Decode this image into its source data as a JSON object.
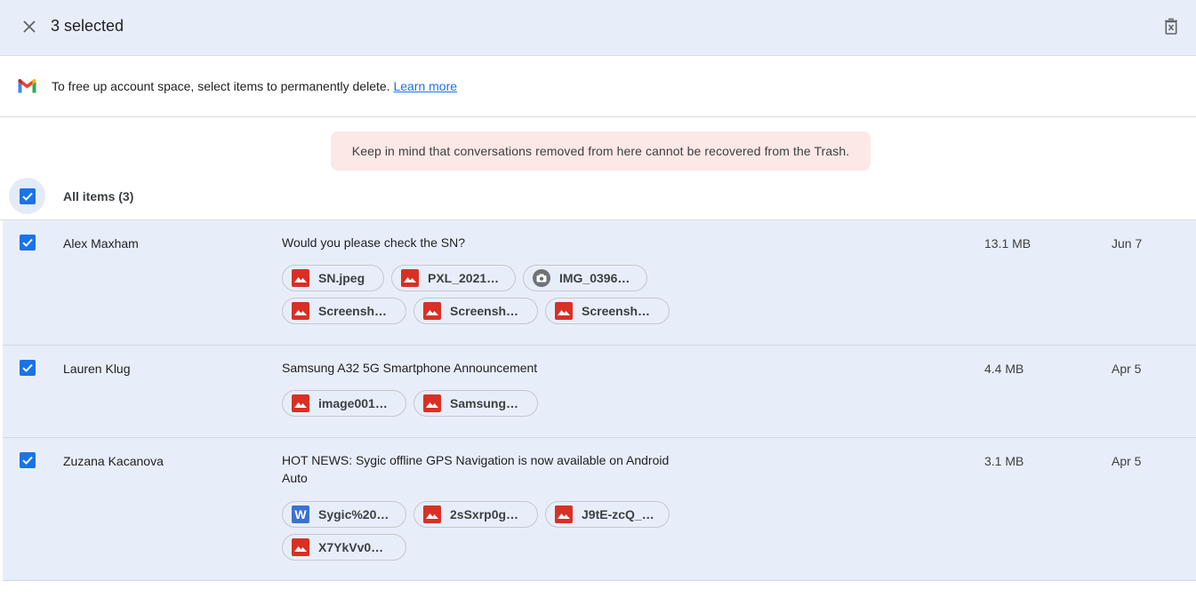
{
  "header": {
    "selected_text": "3 selected",
    "close_icon": "close-icon",
    "delete_icon": "delete-forever-icon"
  },
  "info": {
    "text": "To free up account space, select items to permanently delete.",
    "link": "Learn more"
  },
  "warning": "Keep in mind that conversations removed from here cannot be recovered from the Trash.",
  "all_items": {
    "label": "All items (3)",
    "checked": true
  },
  "colors": {
    "accent": "#1a73e8",
    "selected_row": "#e8eef9",
    "warning_bg": "#fce8e6",
    "image_icon": "#d93025",
    "word_icon": "#3a72d2"
  },
  "rows": [
    {
      "sender": "Alex Maxham",
      "subject": "Would you please check the SN?",
      "size": "13.1 MB",
      "date": "Jun 7",
      "checked": true,
      "attachments": [
        {
          "name": "SN.jpeg",
          "type": "image"
        },
        {
          "name": "PXL_2021…",
          "type": "image"
        },
        {
          "name": "IMG_0396…",
          "type": "camera"
        },
        {
          "name": "Screensh…",
          "type": "image"
        },
        {
          "name": "Screensh…",
          "type": "image"
        },
        {
          "name": "Screensh…",
          "type": "image"
        }
      ]
    },
    {
      "sender": "Lauren Klug",
      "subject": "Samsung A32 5G Smartphone Announcement",
      "size": "4.4 MB",
      "date": "Apr 5",
      "checked": true,
      "attachments": [
        {
          "name": "image001…",
          "type": "image"
        },
        {
          "name": "Samsung…",
          "type": "image"
        }
      ]
    },
    {
      "sender": "Zuzana Kacanova",
      "subject": "HOT NEWS: Sygic offline GPS Navigation is now available on Android Auto",
      "size": "3.1 MB",
      "date": "Apr 5",
      "checked": true,
      "attachments": [
        {
          "name": "Sygic%20…",
          "type": "word",
          "icon_letter": "W"
        },
        {
          "name": "2sSxrp0g…",
          "type": "image"
        },
        {
          "name": "J9tE-zcQ_…",
          "type": "image"
        },
        {
          "name": "X7YkVv0…",
          "type": "image"
        }
      ]
    }
  ]
}
